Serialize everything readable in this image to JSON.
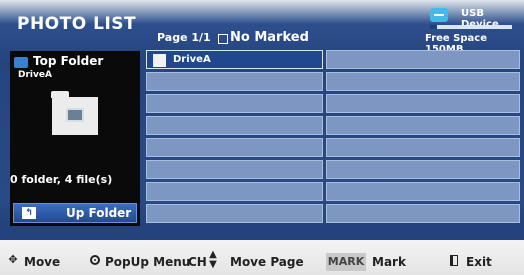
{
  "header": {
    "title": "PHOTO LIST",
    "page_info": "Page 1/1",
    "marked_status": "No Marked",
    "usb_label": "USB Device",
    "free_space": "Free Space 150MB"
  },
  "left_panel": {
    "top_folder_label": "Top Folder",
    "drive_name": "DriveA",
    "count_text": "0 folder, 4 file(s)",
    "up_folder_label": "Up Folder"
  },
  "grid": {
    "items": [
      {
        "label": "DriveA",
        "selected": true
      },
      {
        "label": ""
      },
      {
        "label": ""
      },
      {
        "label": ""
      },
      {
        "label": ""
      },
      {
        "label": ""
      },
      {
        "label": ""
      },
      {
        "label": ""
      },
      {
        "label": ""
      },
      {
        "label": ""
      },
      {
        "label": ""
      },
      {
        "label": ""
      },
      {
        "label": ""
      },
      {
        "label": ""
      },
      {
        "label": ""
      },
      {
        "label": ""
      },
      {
        "label": ""
      },
      {
        "label": ""
      },
      {
        "label": ""
      },
      {
        "label": ""
      }
    ]
  },
  "footer": {
    "move": "Move",
    "popup_menu": "PopUp Menu",
    "ch": "CH",
    "move_page": "Move Page",
    "mark_key": "MARK",
    "mark": "Mark",
    "exit": "Exit"
  },
  "icons": {
    "usb": "usb-icon",
    "top_folder": "folder-icon",
    "photo": "photo-icon",
    "up_folder": "up-folder-icon",
    "move": "four-way-arrows-icon",
    "popup": "ok-circle-icon",
    "page": "up-down-arrows-icon",
    "exit": "exit-icon"
  },
  "colors": {
    "selected_cell": "#21488e",
    "cell": "#7d97c2",
    "background": "#26457f"
  }
}
